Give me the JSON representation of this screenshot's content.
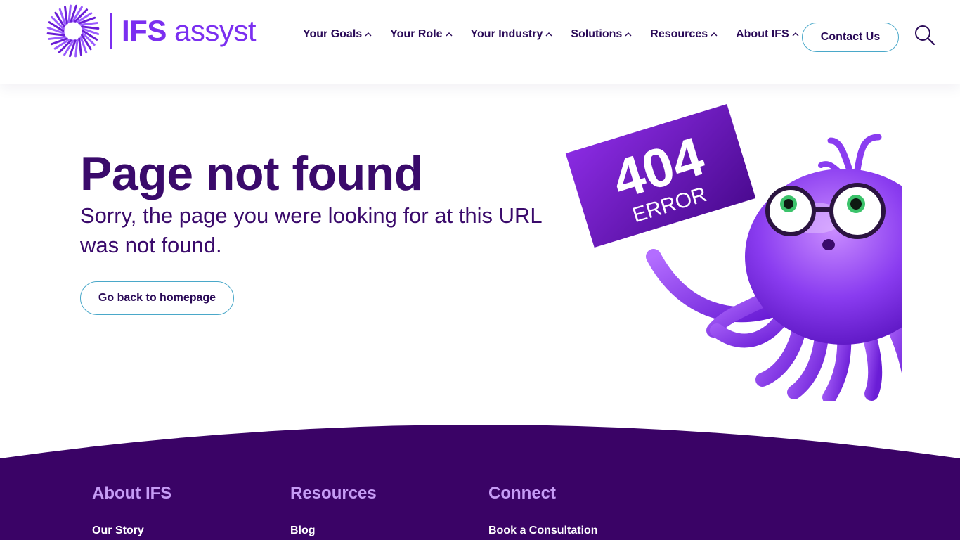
{
  "header": {
    "logo": {
      "brand_bold": "IFS",
      "brand_light": "assyst"
    },
    "nav": [
      {
        "label": "Your Goals",
        "icon": "chevron-up-icon"
      },
      {
        "label": "Your Role",
        "icon": "chevron-up-icon"
      },
      {
        "label": "Your Industry",
        "icon": "chevron-up-icon"
      },
      {
        "label": "Solutions",
        "icon": "chevron-up-icon"
      },
      {
        "label": "Resources",
        "icon": "chevron-up-icon"
      },
      {
        "label": "About IFS",
        "icon": "chevron-up-icon"
      }
    ],
    "contact_label": "Contact Us",
    "search_icon": "search-icon"
  },
  "main": {
    "title": "Page not found",
    "subtitle": "Sorry, the page you were looking for at this URL was not found.",
    "home_button": "Go back to homepage",
    "illustration": {
      "sign_number": "404",
      "sign_word": "ERROR",
      "mascot": "purple-octopus-with-glasses"
    }
  },
  "footer": {
    "columns": [
      {
        "heading": "About IFS",
        "links": [
          "Our Story"
        ]
      },
      {
        "heading": "Resources",
        "links": [
          "Blog"
        ]
      },
      {
        "heading": "Connect",
        "links": [
          "Book a Consultation"
        ]
      }
    ]
  },
  "colors": {
    "brand_purple": "#7b2ff0",
    "text_dark_purple": "#3a0a6b",
    "footer_bg": "#3a0366",
    "footer_heading": "#c69cf5",
    "button_border": "#4aa8c9"
  }
}
